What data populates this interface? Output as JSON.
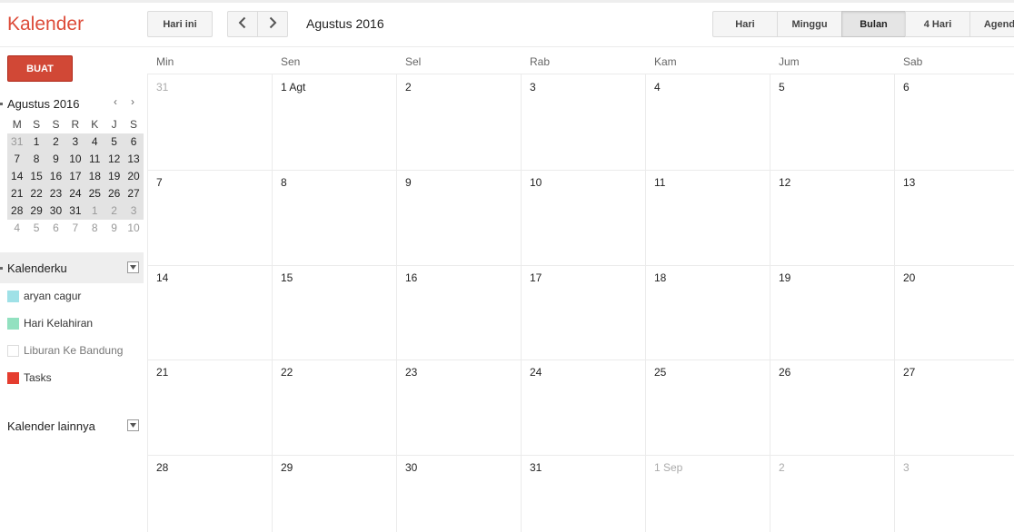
{
  "app": {
    "title": "Kalender"
  },
  "toolbar": {
    "today": "Hari ini",
    "prev_icon": "chevron-left-icon",
    "next_icon": "chevron-right-icon",
    "date_range": "Agustus 2016"
  },
  "views": [
    {
      "label": "Hari",
      "active": false
    },
    {
      "label": "Minggu",
      "active": false
    },
    {
      "label": "Bulan",
      "active": true
    },
    {
      "label": "4 Hari",
      "active": false
    },
    {
      "label": "Agenda",
      "active": false
    }
  ],
  "sidebar": {
    "create": "BUAT",
    "mini": {
      "title": "Agustus 2016",
      "prev": "‹",
      "next": "›",
      "days": [
        "M",
        "S",
        "S",
        "R",
        "K",
        "J",
        "S"
      ],
      "weeks": [
        [
          {
            "d": "31",
            "o": true
          },
          {
            "d": "1"
          },
          {
            "d": "2"
          },
          {
            "d": "3"
          },
          {
            "d": "4"
          },
          {
            "d": "5"
          },
          {
            "d": "6"
          }
        ],
        [
          {
            "d": "7"
          },
          {
            "d": "8"
          },
          {
            "d": "9"
          },
          {
            "d": "10"
          },
          {
            "d": "11"
          },
          {
            "d": "12"
          },
          {
            "d": "13"
          }
        ],
        [
          {
            "d": "14"
          },
          {
            "d": "15"
          },
          {
            "d": "16"
          },
          {
            "d": "17"
          },
          {
            "d": "18"
          },
          {
            "d": "19"
          },
          {
            "d": "20"
          }
        ],
        [
          {
            "d": "21"
          },
          {
            "d": "22"
          },
          {
            "d": "23"
          },
          {
            "d": "24"
          },
          {
            "d": "25"
          },
          {
            "d": "26"
          },
          {
            "d": "27"
          }
        ],
        [
          {
            "d": "28"
          },
          {
            "d": "29"
          },
          {
            "d": "30"
          },
          {
            "d": "31"
          },
          {
            "d": "1",
            "o": true
          },
          {
            "d": "2",
            "o": true
          },
          {
            "d": "3",
            "o": true
          }
        ],
        [
          {
            "d": "4",
            "o": true
          },
          {
            "d": "5",
            "o": true
          },
          {
            "d": "6",
            "o": true
          },
          {
            "d": "7",
            "o": true
          },
          {
            "d": "8",
            "o": true
          },
          {
            "d": "9",
            "o": true
          },
          {
            "d": "10",
            "o": true
          }
        ]
      ]
    },
    "my_calendars": {
      "label": "Kalenderku",
      "items": [
        {
          "name": "aryan cagur",
          "color": "#9fe1e7",
          "dim": false
        },
        {
          "name": "Hari Kelahiran",
          "color": "#92e1c0",
          "dim": false
        },
        {
          "name": "Liburan Ke Bandung",
          "color": "#ffffff",
          "dim": true
        },
        {
          "name": "Tasks",
          "color": "#e53d2f",
          "dim": false
        }
      ]
    },
    "other_calendars": {
      "label": "Kalender lainnya"
    }
  },
  "month": {
    "weekdays": [
      "Min",
      "Sen",
      "Sel",
      "Rab",
      "Kam",
      "Jum",
      "Sab"
    ],
    "weeks": [
      [
        {
          "d": "31",
          "o": true
        },
        {
          "d": "1 Agt"
        },
        {
          "d": "2"
        },
        {
          "d": "3"
        },
        {
          "d": "4"
        },
        {
          "d": "5"
        },
        {
          "d": "6"
        }
      ],
      [
        {
          "d": "7"
        },
        {
          "d": "8"
        },
        {
          "d": "9"
        },
        {
          "d": "10"
        },
        {
          "d": "11"
        },
        {
          "d": "12"
        },
        {
          "d": "13"
        }
      ],
      [
        {
          "d": "14"
        },
        {
          "d": "15"
        },
        {
          "d": "16"
        },
        {
          "d": "17"
        },
        {
          "d": "18"
        },
        {
          "d": "19"
        },
        {
          "d": "20"
        }
      ],
      [
        {
          "d": "21"
        },
        {
          "d": "22"
        },
        {
          "d": "23"
        },
        {
          "d": "24"
        },
        {
          "d": "25"
        },
        {
          "d": "26"
        },
        {
          "d": "27"
        }
      ],
      [
        {
          "d": "28"
        },
        {
          "d": "29"
        },
        {
          "d": "30"
        },
        {
          "d": "31"
        },
        {
          "d": "1 Sep",
          "o": true
        },
        {
          "d": "2",
          "o": true
        },
        {
          "d": "3",
          "o": true
        }
      ]
    ]
  }
}
